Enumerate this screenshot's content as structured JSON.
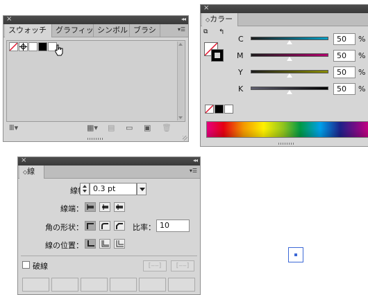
{
  "swatches_panel": {
    "close": "×",
    "collapse": "◂◂",
    "tabs": [
      "スウォッチ",
      "グラフィッ",
      "シンボル",
      "ブラシ"
    ],
    "menu": "▾☰",
    "icons": [
      "libraries-icon",
      "swatch-kind-icon",
      "swatch-options-icon",
      "new-color-group-icon",
      "new-swatch-icon",
      "delete-swatch-icon"
    ]
  },
  "color_panel": {
    "close": "×",
    "collapse": "◂◂",
    "tab": "カラー",
    "tab_prefix": "◇",
    "menu": "▾☰",
    "channels": [
      {
        "label": "C",
        "value": "50",
        "unit": "%",
        "gradient": [
          "#1c1c1c",
          "#009fc6"
        ]
      },
      {
        "label": "M",
        "value": "50",
        "unit": "%",
        "gradient": [
          "#1c1c1c",
          "#b2006d"
        ]
      },
      {
        "label": "Y",
        "value": "50",
        "unit": "%",
        "gradient": [
          "#1c1c1c",
          "#8a8d00"
        ]
      },
      {
        "label": "K",
        "value": "50",
        "unit": "%",
        "gradient": [
          "#5f5f6f",
          "#000000"
        ]
      }
    ],
    "level": 0.5
  },
  "stroke_panel": {
    "close": "×",
    "collapse": "◂◂",
    "tab": "線",
    "tab_prefix": "◇",
    "menu": "▾☰",
    "weight_label": "線幅：",
    "weight_value": "0.3 pt",
    "cap_label": "線端：",
    "corner_label": "角の形状：",
    "limit_label": "比率：",
    "limit_value": "10",
    "align_label": "線の位置：",
    "dashed_label": "破線"
  },
  "artboard": {
    "selected_object": "selected-point"
  }
}
